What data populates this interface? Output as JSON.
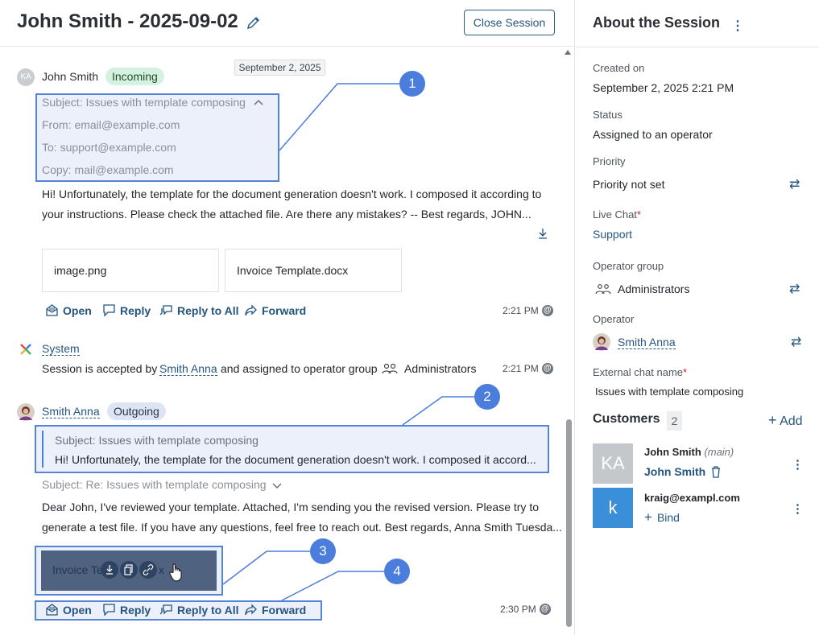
{
  "header": {
    "title": "John Smith - 2025-09-02",
    "close_label": "Close Session"
  },
  "feed": {
    "date_label": "September 2, 2025",
    "msg1": {
      "avatar_initials": "KA",
      "author": "John Smith",
      "badge": "Incoming",
      "subject": "Subject: Issues with template composing",
      "from": "From: email@example.com",
      "to": "To: support@example.com",
      "copy": "Copy: mail@example.com",
      "body_line1": "Hi! Unfortunately, the template for the document generation doesn't work. I composed it according to",
      "body_line2": "your instructions. Please check the attached file. Are there any mistakes? -- Best regards, JOHN...",
      "attachments": [
        "image.png",
        "Invoice Template.docx"
      ],
      "time": "2:21 PM"
    },
    "system": {
      "author": "System",
      "text_pre": "Session is accepted by",
      "operator": "Smith Anna",
      "text_mid": "and assigned to operator group",
      "group": "Administrators",
      "time": "2:21 PM"
    },
    "msg2": {
      "author": "Smith Anna",
      "badge": "Outgoing",
      "quote_subject": "Subject: Issues with template composing",
      "quote_body": "Hi! Unfortunately, the template for the document generation doesn't work. I composed it accord...",
      "subject": "Subject: Re: Issues with template composing",
      "body_line1": "Dear John, I've reviewed your template. Attached, I'm sending you the revised version. Please try to",
      "body_line2": "generate a test file. If you have any questions, feel free to reach out. Best regards, Anna Smith Tuesda...",
      "attachment": "Invoice Te",
      "attachment_tail": "x",
      "time": "2:30 PM"
    },
    "actions": {
      "open": "Open",
      "reply": "Reply",
      "reply_all": "Reply to All",
      "forward": "Forward"
    },
    "callouts": [
      "1",
      "2",
      "3",
      "4"
    ]
  },
  "panel": {
    "title": "About the Session",
    "created_label": "Created on",
    "created_value": "September 2, 2025 2:21 PM",
    "status_label": "Status",
    "status_value": "Assigned to an operator",
    "priority_label": "Priority",
    "priority_value": "Priority not set",
    "livechat_label": "Live Chat",
    "livechat_value": "Support",
    "opgroup_label": "Operator group",
    "opgroup_value": "Administrators",
    "operator_label": "Operator",
    "operator_value": "Smith Anna",
    "extname_label": "External chat name",
    "extname_value": "Issues with template composing",
    "customers_title": "Customers",
    "customers_count": "2",
    "add_label": "Add",
    "customers": [
      {
        "initials": "KA",
        "name": "John Smith",
        "tag": "(main)",
        "link": "John Smith",
        "color": "#c4c7cc"
      },
      {
        "initials": "k",
        "name": "kraig@exampl.com",
        "link": "Bind",
        "color": "#3b8fd9"
      }
    ]
  },
  "colors": {
    "accent": "#24557f",
    "highlight": "#5583d6",
    "incoming_badge": "#d4f2df",
    "outgoing_badge": "#dde5f4"
  }
}
